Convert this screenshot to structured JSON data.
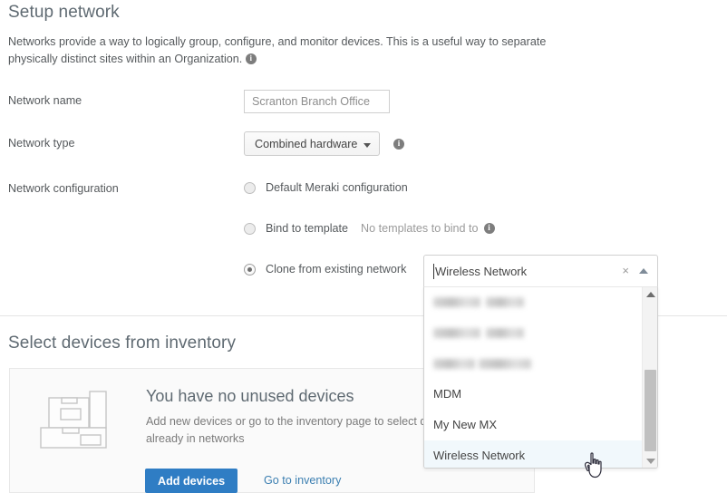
{
  "setup": {
    "title": "Setup network",
    "intro": "Networks provide a way to logically group, configure, and monitor devices. This is a useful way to separate physically distinct sites within an Organization.",
    "intro_info_icon": "info-icon",
    "fields": {
      "network_name_label": "Network name",
      "network_name_value": "Scranton Branch Office",
      "network_name_placeholder": "Scranton Branch Office",
      "network_type_label": "Network type",
      "network_type_value": "Combined hardware",
      "network_type_info_icon": "info-icon",
      "network_config_label": "Network configuration"
    },
    "config_options": [
      {
        "label": "Default Meraki configuration",
        "selected": false
      },
      {
        "label": "Bind to template",
        "selected": false,
        "note": "No templates to bind to",
        "note_info_icon": "info-icon"
      },
      {
        "label": "Clone from existing network",
        "selected": true
      }
    ]
  },
  "combobox": {
    "value": "Wireless Network",
    "clear_icon": "×",
    "toggle_icon": "chevron-up-icon",
    "options": [
      {
        "label": "",
        "redacted": true
      },
      {
        "label": "",
        "redacted": true
      },
      {
        "label": "",
        "redacted": true
      },
      {
        "label": "MDM",
        "redacted": false
      },
      {
        "label": "My New MX",
        "redacted": false
      },
      {
        "label": "Wireless Network",
        "redacted": false,
        "highlighted": true
      }
    ],
    "scrollbar": {
      "up_icon": "caret-up-icon",
      "down_icon": "caret-down-icon"
    }
  },
  "inventory": {
    "title": "Select devices from inventory",
    "empty_heading": "You have no unused devices",
    "empty_sub": "Add new devices or go to the inventory page to select devices that are already in networks",
    "add_button": "Add devices",
    "inventory_link": "Go to inventory",
    "illustration_icon": "stacked-boxes-icon"
  },
  "colors": {
    "primary_button": "#2f7dc4",
    "link": "#3c7fb1",
    "heading": "#5f6a72",
    "body_text": "#55595c",
    "highlight_row": "#f1f8fc"
  }
}
